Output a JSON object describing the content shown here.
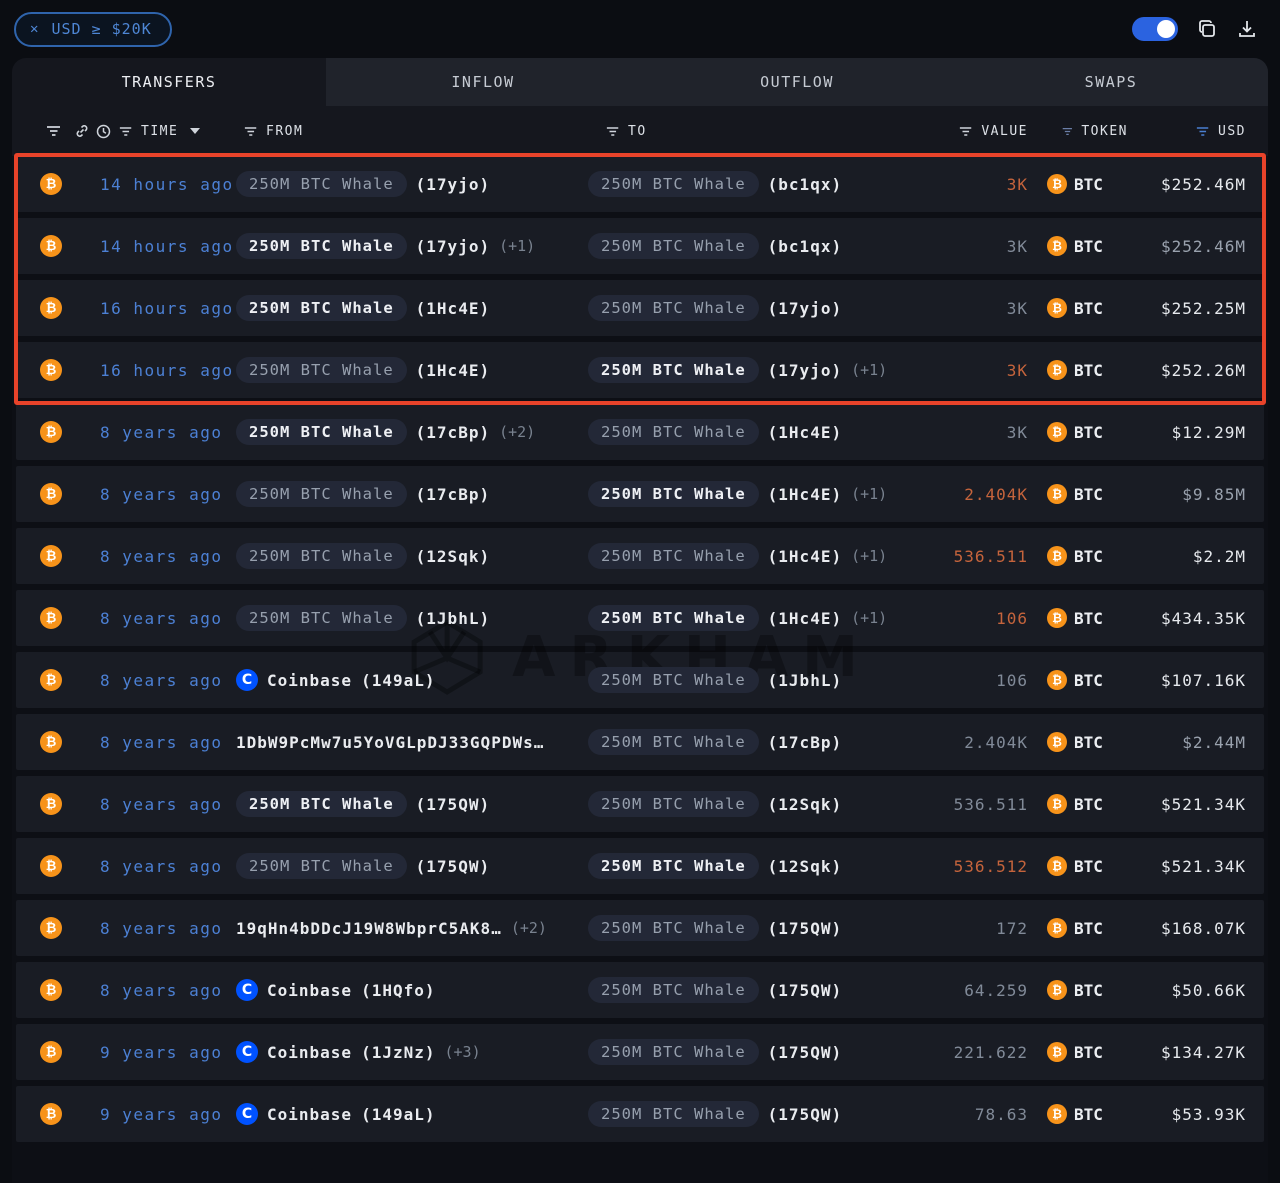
{
  "filter_chip": {
    "close": "✕",
    "label": "USD ≥ $20K"
  },
  "controls": {
    "toggle_on": true
  },
  "tabs": [
    {
      "label": "TRANSFERS",
      "active": true
    },
    {
      "label": "INFLOW",
      "active": false
    },
    {
      "label": "OUTFLOW",
      "active": false
    },
    {
      "label": "SWAPS",
      "active": false
    }
  ],
  "columns": {
    "time": "TIME",
    "from": "FROM",
    "to": "TO",
    "value": "VALUE",
    "token": "TOKEN",
    "usd": "USD"
  },
  "watermark": "ARKHAM",
  "colors": {
    "accent_blue": "#4c80d4",
    "value_hot_orange": "#c5643c",
    "bitcoin_orange": "#f7931a",
    "coinbase_blue": "#0052ff",
    "highlight_red": "#e8432a",
    "toggle_blue": "#2b63e0"
  },
  "rows": [
    {
      "time": "14 hours ago",
      "from": {
        "kind": "entity",
        "name": "250M BTC Whale",
        "addr": "(17yjo)",
        "extra": "",
        "emph": false
      },
      "to": {
        "kind": "entity",
        "name": "250M BTC Whale",
        "addr": "(bc1qx)",
        "extra": "",
        "emph": false
      },
      "value": "3K",
      "value_hot": true,
      "token": "BTC",
      "usd": "$252.46M",
      "usd_dim": false,
      "highlighted": true
    },
    {
      "time": "14 hours ago",
      "from": {
        "kind": "entity",
        "name": "250M BTC Whale",
        "addr": "(17yjo)",
        "extra": "(+1)",
        "emph": true
      },
      "to": {
        "kind": "entity",
        "name": "250M BTC Whale",
        "addr": "(bc1qx)",
        "extra": "",
        "emph": false
      },
      "value": "3K",
      "value_hot": false,
      "token": "BTC",
      "usd": "$252.46M",
      "usd_dim": true,
      "highlighted": true
    },
    {
      "time": "16 hours ago",
      "from": {
        "kind": "entity",
        "name": "250M BTC Whale",
        "addr": "(1Hc4E)",
        "extra": "",
        "emph": true
      },
      "to": {
        "kind": "entity",
        "name": "250M BTC Whale",
        "addr": "(17yjo)",
        "extra": "",
        "emph": false
      },
      "value": "3K",
      "value_hot": false,
      "token": "BTC",
      "usd": "$252.25M",
      "usd_dim": false,
      "highlighted": true
    },
    {
      "time": "16 hours ago",
      "from": {
        "kind": "entity",
        "name": "250M BTC Whale",
        "addr": "(1Hc4E)",
        "extra": "",
        "emph": false
      },
      "to": {
        "kind": "entity",
        "name": "250M BTC Whale",
        "addr": "(17yjo)",
        "extra": "(+1)",
        "emph": true
      },
      "value": "3K",
      "value_hot": true,
      "token": "BTC",
      "usd": "$252.26M",
      "usd_dim": false,
      "highlighted": true
    },
    {
      "time": "8 years ago",
      "from": {
        "kind": "entity",
        "name": "250M BTC Whale",
        "addr": "(17cBp)",
        "extra": "(+2)",
        "emph": true
      },
      "to": {
        "kind": "entity",
        "name": "250M BTC Whale",
        "addr": "(1Hc4E)",
        "extra": "",
        "emph": false
      },
      "value": "3K",
      "value_hot": false,
      "token": "BTC",
      "usd": "$12.29M",
      "usd_dim": false,
      "highlighted": false
    },
    {
      "time": "8 years ago",
      "from": {
        "kind": "entity",
        "name": "250M BTC Whale",
        "addr": "(17cBp)",
        "extra": "",
        "emph": false
      },
      "to": {
        "kind": "entity",
        "name": "250M BTC Whale",
        "addr": "(1Hc4E)",
        "extra": "(+1)",
        "emph": true
      },
      "value": "2.404K",
      "value_hot": true,
      "token": "BTC",
      "usd": "$9.85M",
      "usd_dim": true,
      "highlighted": false
    },
    {
      "time": "8 years ago",
      "from": {
        "kind": "entity",
        "name": "250M BTC Whale",
        "addr": "(12Sqk)",
        "extra": "",
        "emph": false
      },
      "to": {
        "kind": "entity",
        "name": "250M BTC Whale",
        "addr": "(1Hc4E)",
        "extra": "(+1)",
        "emph": false
      },
      "value": "536.511",
      "value_hot": true,
      "token": "BTC",
      "usd": "$2.2M",
      "usd_dim": false,
      "highlighted": false
    },
    {
      "time": "8 years ago",
      "from": {
        "kind": "entity",
        "name": "250M BTC Whale",
        "addr": "(1JbhL)",
        "extra": "",
        "emph": false
      },
      "to": {
        "kind": "entity",
        "name": "250M BTC Whale",
        "addr": "(1Hc4E)",
        "extra": "(+1)",
        "emph": true
      },
      "value": "106",
      "value_hot": true,
      "token": "BTC",
      "usd": "$434.35K",
      "usd_dim": false,
      "highlighted": false
    },
    {
      "time": "8 years ago",
      "from": {
        "kind": "exchange",
        "name": "Coinbase",
        "addr": "(149aL)",
        "extra": "",
        "emph": false
      },
      "to": {
        "kind": "entity",
        "name": "250M BTC Whale",
        "addr": "(1JbhL)",
        "extra": "",
        "emph": false
      },
      "value": "106",
      "value_hot": false,
      "token": "BTC",
      "usd": "$107.16K",
      "usd_dim": false,
      "highlighted": false
    },
    {
      "time": "8 years ago",
      "from": {
        "kind": "address",
        "name": "",
        "addr": "1DbW9PcMw7u5YoVGLpDJ33GQPDWs…",
        "extra": "",
        "emph": false
      },
      "to": {
        "kind": "entity",
        "name": "250M BTC Whale",
        "addr": "(17cBp)",
        "extra": "",
        "emph": false
      },
      "value": "2.404K",
      "value_hot": false,
      "token": "BTC",
      "usd": "$2.44M",
      "usd_dim": true,
      "highlighted": false
    },
    {
      "time": "8 years ago",
      "from": {
        "kind": "entity",
        "name": "250M BTC Whale",
        "addr": "(175QW)",
        "extra": "",
        "emph": true
      },
      "to": {
        "kind": "entity",
        "name": "250M BTC Whale",
        "addr": "(12Sqk)",
        "extra": "",
        "emph": false
      },
      "value": "536.511",
      "value_hot": false,
      "token": "BTC",
      "usd": "$521.34K",
      "usd_dim": false,
      "highlighted": false
    },
    {
      "time": "8 years ago",
      "from": {
        "kind": "entity",
        "name": "250M BTC Whale",
        "addr": "(175QW)",
        "extra": "",
        "emph": false
      },
      "to": {
        "kind": "entity",
        "name": "250M BTC Whale",
        "addr": "(12Sqk)",
        "extra": "",
        "emph": true
      },
      "value": "536.512",
      "value_hot": true,
      "token": "BTC",
      "usd": "$521.34K",
      "usd_dim": false,
      "highlighted": false
    },
    {
      "time": "8 years ago",
      "from": {
        "kind": "address",
        "name": "",
        "addr": "19qHn4bDDcJ19W8WbprC5AK8…",
        "extra": " (+2)",
        "emph": false
      },
      "to": {
        "kind": "entity",
        "name": "250M BTC Whale",
        "addr": "(175QW)",
        "extra": "",
        "emph": false
      },
      "value": "172",
      "value_hot": false,
      "token": "BTC",
      "usd": "$168.07K",
      "usd_dim": false,
      "highlighted": false
    },
    {
      "time": "8 years ago",
      "from": {
        "kind": "exchange",
        "name": "Coinbase",
        "addr": "(1HQfo)",
        "extra": "",
        "emph": false
      },
      "to": {
        "kind": "entity",
        "name": "250M BTC Whale",
        "addr": "(175QW)",
        "extra": "",
        "emph": false
      },
      "value": "64.259",
      "value_hot": false,
      "token": "BTC",
      "usd": "$50.66K",
      "usd_dim": false,
      "highlighted": false
    },
    {
      "time": "9 years ago",
      "from": {
        "kind": "exchange",
        "name": "Coinbase",
        "addr": "(1JzNz)",
        "extra": "(+3)",
        "emph": false
      },
      "to": {
        "kind": "entity",
        "name": "250M BTC Whale",
        "addr": "(175QW)",
        "extra": "",
        "emph": false
      },
      "value": "221.622",
      "value_hot": false,
      "token": "BTC",
      "usd": "$134.27K",
      "usd_dim": false,
      "highlighted": false
    },
    {
      "time": "9 years ago",
      "from": {
        "kind": "exchange",
        "name": "Coinbase",
        "addr": "(149aL)",
        "extra": "",
        "emph": false
      },
      "to": {
        "kind": "entity",
        "name": "250M BTC Whale",
        "addr": "(175QW)",
        "extra": "",
        "emph": false
      },
      "value": "78.63",
      "value_hot": false,
      "token": "BTC",
      "usd": "$53.93K",
      "usd_dim": false,
      "highlighted": false
    }
  ]
}
